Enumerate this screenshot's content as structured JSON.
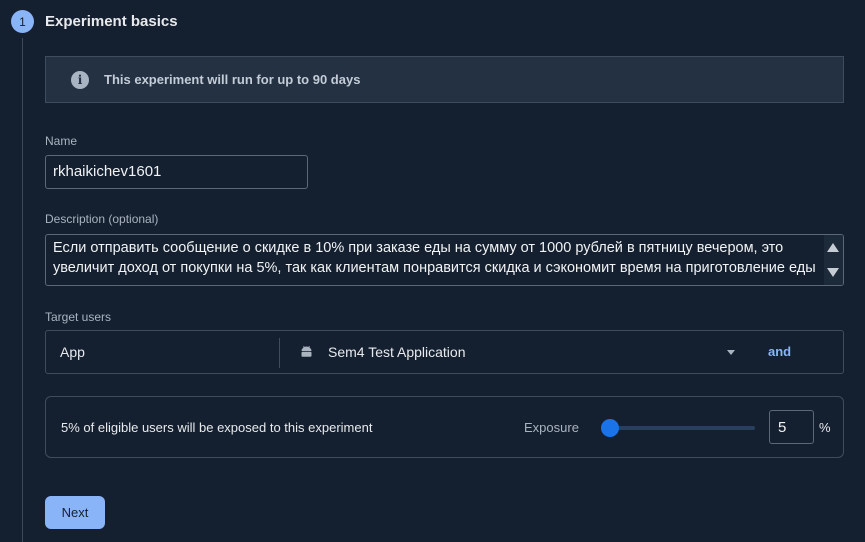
{
  "step": {
    "number": "1",
    "title": "Experiment basics"
  },
  "info_banner": {
    "icon": "info-icon",
    "text": "This experiment will run for up to 90 days"
  },
  "name_field": {
    "label": "Name",
    "value": "rkhaikichev1601"
  },
  "description_field": {
    "label": "Description (optional)",
    "value": "Если отправить сообщение о скидке в 10% при заказе еды на сумму от 1000 рублей в пятницу вечером, это увеличит доход от покупки на 5%, так как клиентам понравится скидка и сэкономит время на приготовление еды"
  },
  "target_users": {
    "label": "Target users",
    "type_value": "App",
    "app_icon": "android-icon",
    "app_name": "Sem4 Test Application",
    "and_label": "and"
  },
  "exposure": {
    "summary": "5% of eligible users will be exposed to this experiment",
    "label": "Exposure",
    "value": "5",
    "percent_fraction": 0.05,
    "unit": "%"
  },
  "next_button": {
    "label": "Next"
  },
  "colors": {
    "background": "#14202f",
    "accent": "#8ab4f8",
    "slider": "#1a73e8"
  }
}
